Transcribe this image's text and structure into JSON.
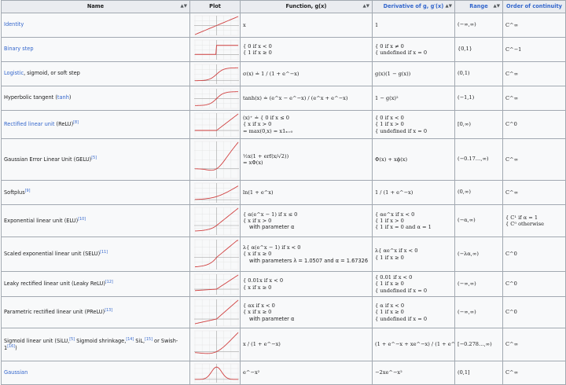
{
  "header": {
    "name": "Name",
    "plot": "Plot",
    "function": "Function, g(x)",
    "derivative": "Derivative of g, g′(x)",
    "range": "Range",
    "continuity": "Order of continuity",
    "sort_icon": "sort-icon"
  },
  "rows": [
    {
      "name_parts": [
        {
          "text": "Identity",
          "link": true
        }
      ],
      "plot": "identity",
      "function": [
        "x"
      ],
      "derivative": [
        "1"
      ],
      "range": "(−∞,∞)",
      "continuity": [
        "C^∞"
      ]
    },
    {
      "name_parts": [
        {
          "text": "Binary step",
          "link": true
        }
      ],
      "plot": "step",
      "function": [
        "{ 0   if x < 0",
        "{ 1   if x ≥ 0"
      ],
      "derivative": [
        "{ 0            if x ≠ 0",
        "{ undefined    if x = 0"
      ],
      "range": "{0,1}",
      "continuity": [
        "C^−1"
      ]
    },
    {
      "name_parts": [
        {
          "text": "Logistic",
          "link": true
        },
        {
          "text": ", sigmoid, or soft step",
          "link": false
        }
      ],
      "plot": "logistic",
      "function": [
        "σ(x) ≐ 1 / (1 + e^−x)"
      ],
      "derivative": [
        "g(x)(1 − g(x))"
      ],
      "range": "(0,1)",
      "continuity": [
        "C^∞"
      ]
    },
    {
      "name_parts": [
        {
          "text": "Hyperbolic tangent (",
          "link": false
        },
        {
          "text": "tanh",
          "link": true
        },
        {
          "text": ")",
          "link": false
        }
      ],
      "plot": "tanh",
      "function": [
        "tanh(x) ≐ (e^x − e^−x) / (e^x + e^−x)"
      ],
      "derivative": [
        "1 − g(x)²"
      ],
      "range": "(−1,1)",
      "continuity": [
        "C^∞"
      ]
    },
    {
      "name_parts": [
        {
          "text": "Rectified linear unit",
          "link": true
        },
        {
          "text": " (ReLU)",
          "link": false
        },
        {
          "text": "[8]",
          "link": true,
          "sup": true
        }
      ],
      "plot": "relu",
      "function": [
        "(x)⁺ ≐ { 0   if x ≤ 0",
        "           { x   if x > 0",
        "   = max(0,x) = x1ₓ₌₀"
      ],
      "derivative": [
        "{ 0            if x < 0",
        "{ 1            if x > 0",
        "{ undefined    if x = 0"
      ],
      "range": "[0,∞)",
      "continuity": [
        "C^0"
      ]
    },
    {
      "name_parts": [
        {
          "text": "Gaussian Error Linear Unit (GELU)",
          "link": false
        },
        {
          "text": "[5]",
          "link": true,
          "sup": true
        }
      ],
      "plot": "gelu",
      "function": [
        "½x(1 + erf(x/√2))",
        "= xΦ(x)"
      ],
      "derivative": [
        "Φ(x) + xϕ(x)"
      ],
      "range": "(−0.17…,∞)",
      "continuity": [
        "C^∞"
      ]
    },
    {
      "name_parts": [
        {
          "text": "Softplus",
          "link": false
        },
        {
          "text": "[9]",
          "link": true,
          "sup": true
        }
      ],
      "plot": "softplus",
      "function": [
        "ln(1 + e^x)"
      ],
      "derivative": [
        "1 / (1 + e^−x)"
      ],
      "range": "(0,∞)",
      "continuity": [
        "C^∞"
      ]
    },
    {
      "name_parts": [
        {
          "text": "Exponential linear unit (ELU)",
          "link": false
        },
        {
          "text": "[10]",
          "link": true,
          "sup": true
        }
      ],
      "plot": "elu",
      "function": [
        "{ α(e^x − 1)   if x ≤ 0",
        "{ x               if x > 0",
        "with parameter α"
      ],
      "derivative": [
        "{ αe^x   if x < 0",
        "{ 1        if x > 0",
        "{ 1        if x = 0 and α = 1"
      ],
      "range": "(−α,∞)",
      "continuity": [
        "{ C¹   if α = 1",
        "{ C⁰   otherwise"
      ]
    },
    {
      "name_parts": [
        {
          "text": "Scaled exponential linear unit (SELU)",
          "link": false
        },
        {
          "text": "[11]",
          "link": true,
          "sup": true
        }
      ],
      "plot": "selu",
      "function": [
        "λ{ α(e^x − 1)   if x < 0",
        "   { x               if x ≥ 0",
        "with parameters λ = 1.0507 and α = 1.67326"
      ],
      "derivative": [
        "λ{ αe^x   if x < 0",
        "   { 1        if x ≥ 0"
      ],
      "range": "(−λα,∞)",
      "continuity": [
        "C^0"
      ]
    },
    {
      "name_parts": [
        {
          "text": "Leaky rectified linear unit (Leaky ReLU)",
          "link": false
        },
        {
          "text": "[12]",
          "link": true,
          "sup": true
        }
      ],
      "plot": "leaky",
      "function": [
        "{ 0.01x   if x < 0",
        "{ x         if x ≥ 0"
      ],
      "derivative": [
        "{ 0.01          if x < 0",
        "{ 1             if x ≥ 0",
        "{ undefined     if x = 0"
      ],
      "range": "(−∞,∞)",
      "continuity": [
        "C^0"
      ]
    },
    {
      "name_parts": [
        {
          "text": "Parametric rectified linear unit (PReLU)",
          "link": false
        },
        {
          "text": "[13]",
          "link": true,
          "sup": true
        }
      ],
      "plot": "prelu",
      "function": [
        "{ αx   if x < 0",
        "{ x    if x ≥ 0",
        "with parameter α"
      ],
      "derivative": [
        "{ α              if x < 0",
        "{ 1              if x ≥ 0",
        "{ undefined     if x = 0"
      ],
      "range": "(−∞,∞)",
      "continuity": [
        "C^0"
      ]
    },
    {
      "name_parts": [
        {
          "text": "Sigmoid linear unit (SiLU,",
          "link": false
        },
        {
          "text": "[5]",
          "link": true,
          "sup": true
        },
        {
          "text": " Sigmoid shrinkage,",
          "link": false
        },
        {
          "text": "[14]",
          "link": true,
          "sup": true
        },
        {
          "text": " SiL,",
          "link": false
        },
        {
          "text": "[15]",
          "link": true,
          "sup": true
        },
        {
          "text": " or Swish-1",
          "link": false
        },
        {
          "text": "[16]",
          "link": true,
          "sup": true
        },
        {
          "text": ")",
          "link": false
        }
      ],
      "plot": "silu",
      "function": [
        "x / (1 + e^−x)"
      ],
      "derivative": [
        "(1 + e^−x + xe^−x) / (1 + e^−x)²"
      ],
      "range": "[−0.278…,∞)",
      "continuity": [
        "C^∞"
      ]
    },
    {
      "name_parts": [
        {
          "text": "Gaussian",
          "link": true
        }
      ],
      "plot": "gaussian",
      "function": [
        "e^−x²"
      ],
      "derivative": [
        "−2xe^−x²"
      ],
      "range": "(0,1]",
      "continuity": [
        "C^∞"
      ]
    }
  ]
}
